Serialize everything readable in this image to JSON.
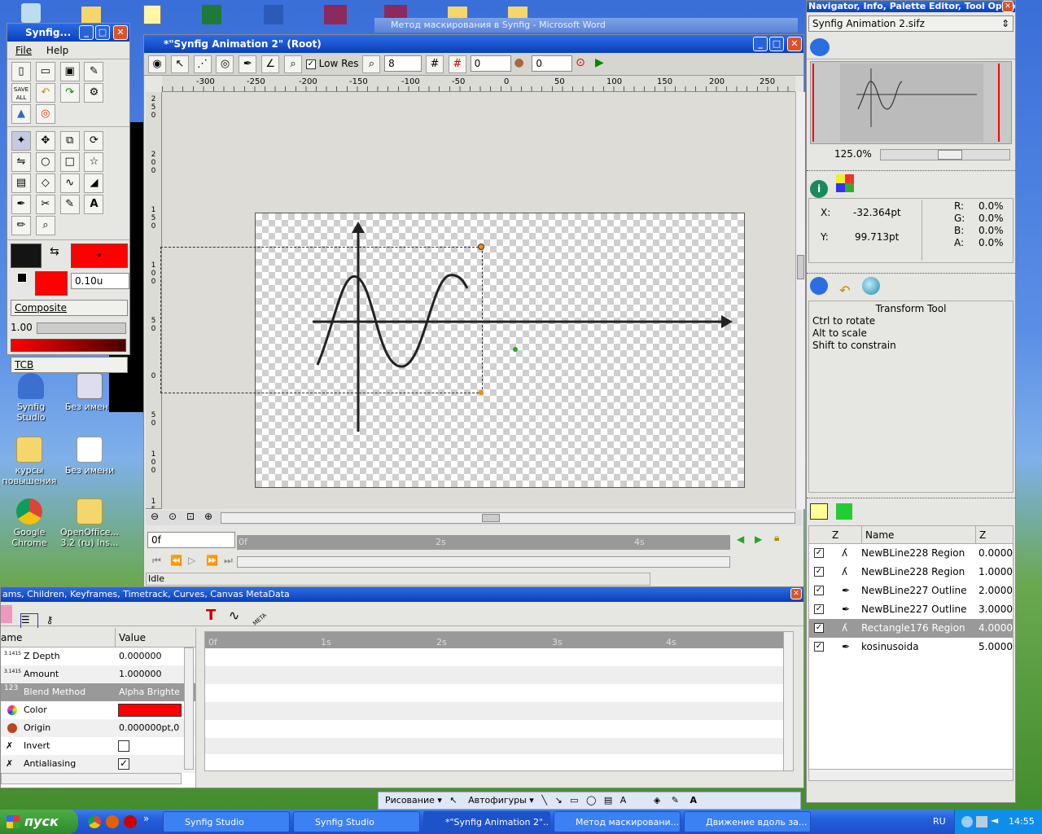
{
  "desktop": {
    "icons": [
      {
        "label": "Synfig Studio"
      },
      {
        "label": "Без имени"
      },
      {
        "label": "курсы повышения"
      },
      {
        "label": "Без имени"
      },
      {
        "label": "Google Chrome"
      },
      {
        "label": "OpenOffice... 3.2 (ru) Ins..."
      }
    ],
    "bg_fragment": "Метод маскирования в Synfig - Microsoft Word"
  },
  "toolbox": {
    "title": "Synfig...",
    "menu": [
      "File",
      "Help"
    ],
    "save_all": "SAVE ALL",
    "outline_width": "0.10u",
    "blend": "Composite",
    "amount": "1.00",
    "interp": "TCB",
    "colors": {
      "outline": "#141414",
      "fill": "#ff0000"
    }
  },
  "canvas_window": {
    "title": "*\"Synfig Animation 2\" (Root)",
    "low_res_label": "Low Res",
    "low_res_checked": "✓",
    "res_value": "8",
    "onion_past": "0",
    "onion_future": "0",
    "ruler_ticks": [
      "-300",
      "-250",
      "-200",
      "-150",
      "-100",
      "-50",
      "0",
      "50",
      "100",
      "150",
      "200",
      "250"
    ],
    "vruler_ticks": [
      "2",
      "5",
      "0",
      "2",
      "0",
      "0",
      "1",
      "5",
      "0",
      "1",
      "0",
      "0",
      "5",
      "0",
      "0",
      "5",
      "0",
      "1",
      "0",
      "0",
      "1",
      "5",
      "0"
    ],
    "time_field": "0f",
    "time_marks": [
      "0f",
      "2s",
      "4s"
    ],
    "status": "Idle"
  },
  "navigator": {
    "title": "Navigator, Info, Palette Editor, Tool Optio...",
    "file_select": "Synfig Animation 2.sifz",
    "zoom": "125.0%"
  },
  "info": {
    "x_label": "X:",
    "x_value": "-32.364pt",
    "y_label": "Y:",
    "y_value": "99.713pt",
    "r_label": "R:",
    "r_value": "0.0%",
    "g_label": "G:",
    "g_value": "0.0%",
    "b_label": "B:",
    "b_value": "0.0%",
    "a_label": "A:",
    "a_value": "0.0%"
  },
  "tool_options": {
    "title": "Transform Tool",
    "lines": [
      "Ctrl to rotate",
      "Alt to scale",
      "Shift to constrain"
    ]
  },
  "layers": {
    "col_z": "Z",
    "col_name": "Name",
    "col_z2": "Z",
    "rows": [
      {
        "name": "NewBLine228 Region",
        "z": "0.00000",
        "check": "✓"
      },
      {
        "name": "NewBLine228 Region",
        "z": "1.00000",
        "check": "✓"
      },
      {
        "name": "NewBLine227 Outline",
        "z": "2.00000",
        "check": "✓"
      },
      {
        "name": "NewBLine227 Outline",
        "z": "3.00000",
        "check": "✓"
      },
      {
        "name": "Rectangle176 Region",
        "z": "4.00000",
        "check": "✓"
      },
      {
        "name": "kosinusoida",
        "z": "5.00000",
        "check": "✓"
      }
    ]
  },
  "params": {
    "title": "ams, Children, Keyframes, Timetrack, Curves, Canvas MetaData",
    "col_name": "ame",
    "col_value": "Value",
    "rows": [
      {
        "name": "Z Depth",
        "value": "0.000000"
      },
      {
        "name": "Amount",
        "value": "1.000000"
      },
      {
        "name": "Blend Method",
        "value": "Alpha Brighte"
      },
      {
        "name": "Color",
        "value": ""
      },
      {
        "name": "Origin",
        "value": "0.000000pt,0"
      },
      {
        "name": "Invert",
        "value": ""
      },
      {
        "name": "Antialiasing",
        "value": "✓"
      }
    ],
    "tt_marks": [
      "0f",
      "1s",
      "2s",
      "3s",
      "4s"
    ]
  },
  "word_toolbar": {
    "draw_label": "Рисование",
    "autoshapes": "Автофигуры"
  },
  "taskbar": {
    "start": "пуск",
    "tasks": [
      "Synfig Studio",
      "Synfig Studio",
      "*\"Synfig Animation 2\"...",
      "Метод маскировани...",
      "Движение вдоль за..."
    ],
    "lang": "RU",
    "clock": "14:55"
  }
}
